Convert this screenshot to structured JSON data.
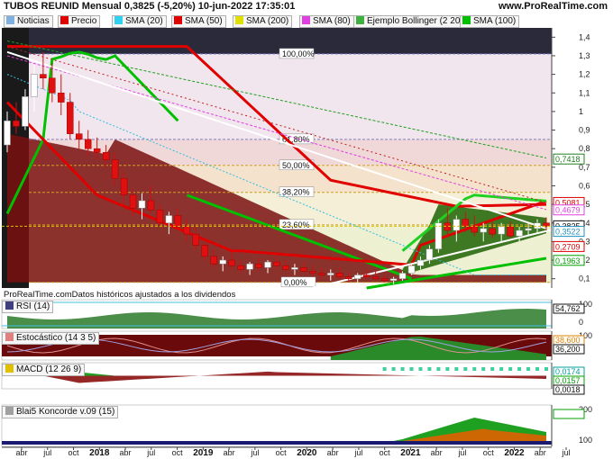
{
  "header": {
    "title": "TUBOS REUNID Mensual 0,3825 (-5,20%) 10-jun-2022 17:35:01",
    "site": "www.ProRealTime.com"
  },
  "legend": [
    {
      "label": "Noticias",
      "color": "#7fb0e0",
      "icon": "checkbox-icon"
    },
    {
      "label": "Precio",
      "color": "#e00000"
    },
    {
      "label": "SMA (20)",
      "color": "#30d0f0"
    },
    {
      "label": "SMA (50)",
      "color": "#e00000"
    },
    {
      "label": "SMA (200)",
      "color": "#e0e000"
    },
    {
      "label": "SMA (80)",
      "color": "#e040e0"
    },
    {
      "label": "Ejemplo Bollinger (2 20)",
      "color": "#40b040"
    },
    {
      "label": "SMA (100)",
      "color": "#00c000"
    }
  ],
  "footer_note": "ProRealTime.comDatos históricos ajustados a los dividendos",
  "fibonacci": [
    {
      "label": "100,00%",
      "value": 1.31
    },
    {
      "label": "61,80%",
      "value": 0.85
    },
    {
      "label": "50,00%",
      "value": 0.71
    },
    {
      "label": "38,20%",
      "value": 0.565
    },
    {
      "label": "23,60%",
      "value": 0.39
    },
    {
      "label": "0,00%",
      "value": 0.08
    }
  ],
  "price_tags": [
    {
      "label": "0,5081",
      "value": 0.5081,
      "bg": "#ffffff",
      "fg": "#e00000",
      "border": "#e00000"
    },
    {
      "label": "0,4679",
      "value": 0.4679,
      "bg": "#ffffff",
      "fg": "#e040e0",
      "border": "#e040e0"
    },
    {
      "label": "0,3825",
      "value": 0.3825,
      "bg": "#ffffff",
      "fg": "#111111",
      "border": "#111111"
    },
    {
      "label": "0,3522",
      "value": 0.3522,
      "bg": "#ffffff",
      "fg": "#2090c0",
      "border": "#2090c0"
    },
    {
      "label": "0,2709",
      "value": 0.2709,
      "bg": "#ffffff",
      "fg": "#e00000",
      "border": "#e00000"
    },
    {
      "label": "0,1963",
      "value": 0.1963,
      "bg": "#ffffff",
      "fg": "#00a000",
      "border": "#00a000"
    },
    {
      "label": "0,7418",
      "value": 0.7418,
      "bg": "#ffffff",
      "fg": "#208020",
      "border": "#208020"
    }
  ],
  "indicators": [
    {
      "name": "RSI (14)",
      "icon": "rsi-icon",
      "color": "#404080",
      "axis": [
        "100",
        "0"
      ],
      "tags": [
        {
          "label": "54,762",
          "color": "#111111"
        }
      ]
    },
    {
      "name": "Estocástico (14 3 5)",
      "icon": "stochastic-icon",
      "color": "#e08080",
      "axis": [
        "100"
      ],
      "tags": [
        {
          "label": "38,600",
          "color": "#e08000"
        },
        {
          "label": "36,200",
          "color": "#111111"
        }
      ]
    },
    {
      "name": "MACD (12 26 9)",
      "icon": "macd-icon",
      "color": "#e0c000",
      "axis": [],
      "tags": [
        {
          "label": "0,0174",
          "color": "#00a0a0"
        },
        {
          "label": "0,0157",
          "color": "#00a000"
        },
        {
          "label": "0,0018",
          "color": "#111111"
        }
      ]
    },
    {
      "name": "Blai5 Koncorde v.09 (15)",
      "icon": "koncorde-icon",
      "color": "#a0a0a0",
      "axis": [
        "200",
        "100"
      ],
      "tags": [
        {
          "label": "",
          "color": "#00a000"
        }
      ]
    }
  ],
  "chart_data": {
    "type": "candlestick",
    "y_axis_ticks": [
      "1,4",
      "1,3",
      "1,2",
      "1,1",
      "1",
      "0,9",
      "0,8",
      "0,7",
      "0,6",
      "0,5",
      "0,4",
      "0,3",
      "0,2",
      "0,1"
    ],
    "ylim": [
      0.05,
      1.45
    ],
    "x_axis_labels": [
      {
        "label": "abr",
        "bold": false
      },
      {
        "label": "jul",
        "bold": false
      },
      {
        "label": "oct",
        "bold": false
      },
      {
        "label": "2018",
        "bold": true
      },
      {
        "label": "abr",
        "bold": false
      },
      {
        "label": "jul",
        "bold": false
      },
      {
        "label": "oct",
        "bold": false
      },
      {
        "label": "2019",
        "bold": true
      },
      {
        "label": "abr",
        "bold": false
      },
      {
        "label": "jul",
        "bold": false
      },
      {
        "label": "oct",
        "bold": false
      },
      {
        "label": "2020",
        "bold": true
      },
      {
        "label": "abr",
        "bold": false
      },
      {
        "label": "jul",
        "bold": false
      },
      {
        "label": "oct",
        "bold": false
      },
      {
        "label": "2021",
        "bold": true
      },
      {
        "label": "abr",
        "bold": false
      },
      {
        "label": "jul",
        "bold": false
      },
      {
        "label": "oct",
        "bold": false
      },
      {
        "label": "2022",
        "bold": true
      },
      {
        "label": "abr",
        "bold": false
      },
      {
        "label": "jul",
        "bold": false
      }
    ],
    "candles": [
      [
        0.82,
        1.0,
        0.78,
        0.95
      ],
      [
        0.95,
        1.05,
        0.88,
        0.92
      ],
      [
        0.92,
        1.12,
        0.9,
        1.08
      ],
      [
        1.08,
        1.25,
        1.0,
        1.2
      ],
      [
        1.2,
        1.32,
        1.12,
        1.18
      ],
      [
        1.18,
        1.26,
        1.05,
        1.1
      ],
      [
        1.1,
        1.2,
        0.98,
        1.05
      ],
      [
        1.05,
        1.1,
        0.85,
        0.88
      ],
      [
        0.88,
        0.95,
        0.8,
        0.85
      ],
      [
        0.85,
        0.9,
        0.76,
        0.8
      ],
      [
        0.8,
        0.86,
        0.74,
        0.78
      ],
      [
        0.78,
        0.82,
        0.7,
        0.74
      ],
      [
        0.74,
        0.78,
        0.6,
        0.64
      ],
      [
        0.64,
        0.68,
        0.5,
        0.55
      ],
      [
        0.55,
        0.58,
        0.44,
        0.48
      ],
      [
        0.48,
        0.56,
        0.42,
        0.52
      ],
      [
        0.52,
        0.6,
        0.45,
        0.47
      ],
      [
        0.47,
        0.5,
        0.38,
        0.4
      ],
      [
        0.4,
        0.46,
        0.34,
        0.44
      ],
      [
        0.44,
        0.48,
        0.36,
        0.38
      ],
      [
        0.38,
        0.42,
        0.3,
        0.34
      ],
      [
        0.34,
        0.38,
        0.26,
        0.28
      ],
      [
        0.28,
        0.32,
        0.2,
        0.22
      ],
      [
        0.22,
        0.26,
        0.16,
        0.18
      ],
      [
        0.18,
        0.22,
        0.14,
        0.2
      ],
      [
        0.2,
        0.24,
        0.15,
        0.17
      ],
      [
        0.17,
        0.2,
        0.13,
        0.15
      ],
      [
        0.15,
        0.19,
        0.12,
        0.18
      ],
      [
        0.18,
        0.21,
        0.14,
        0.16
      ],
      [
        0.16,
        0.2,
        0.13,
        0.19
      ],
      [
        0.19,
        0.22,
        0.15,
        0.17
      ],
      [
        0.17,
        0.2,
        0.14,
        0.15
      ],
      [
        0.15,
        0.18,
        0.12,
        0.16
      ],
      [
        0.16,
        0.19,
        0.13,
        0.14
      ],
      [
        0.14,
        0.17,
        0.11,
        0.13
      ],
      [
        0.13,
        0.16,
        0.1,
        0.12
      ],
      [
        0.12,
        0.15,
        0.09,
        0.13
      ],
      [
        0.13,
        0.16,
        0.1,
        0.11
      ],
      [
        0.11,
        0.14,
        0.08,
        0.1
      ],
      [
        0.1,
        0.13,
        0.08,
        0.12
      ],
      [
        0.12,
        0.15,
        0.1,
        0.11
      ],
      [
        0.11,
        0.14,
        0.09,
        0.1
      ],
      [
        0.1,
        0.12,
        0.08,
        0.09
      ],
      [
        0.09,
        0.11,
        0.07,
        0.1
      ],
      [
        0.1,
        0.14,
        0.09,
        0.13
      ],
      [
        0.13,
        0.18,
        0.12,
        0.17
      ],
      [
        0.17,
        0.22,
        0.15,
        0.2
      ],
      [
        0.2,
        0.28,
        0.18,
        0.26
      ],
      [
        0.26,
        0.42,
        0.24,
        0.4
      ],
      [
        0.4,
        0.48,
        0.32,
        0.36
      ],
      [
        0.36,
        0.44,
        0.3,
        0.42
      ],
      [
        0.42,
        0.46,
        0.35,
        0.38
      ],
      [
        0.38,
        0.44,
        0.33,
        0.35
      ],
      [
        0.35,
        0.4,
        0.3,
        0.37
      ],
      [
        0.37,
        0.42,
        0.32,
        0.34
      ],
      [
        0.34,
        0.4,
        0.3,
        0.38
      ],
      [
        0.38,
        0.41,
        0.32,
        0.33
      ],
      [
        0.33,
        0.38,
        0.3,
        0.36
      ],
      [
        0.36,
        0.4,
        0.33,
        0.37
      ],
      [
        0.37,
        0.42,
        0.34,
        0.4
      ],
      [
        0.4,
        0.43,
        0.36,
        0.3825
      ]
    ]
  }
}
